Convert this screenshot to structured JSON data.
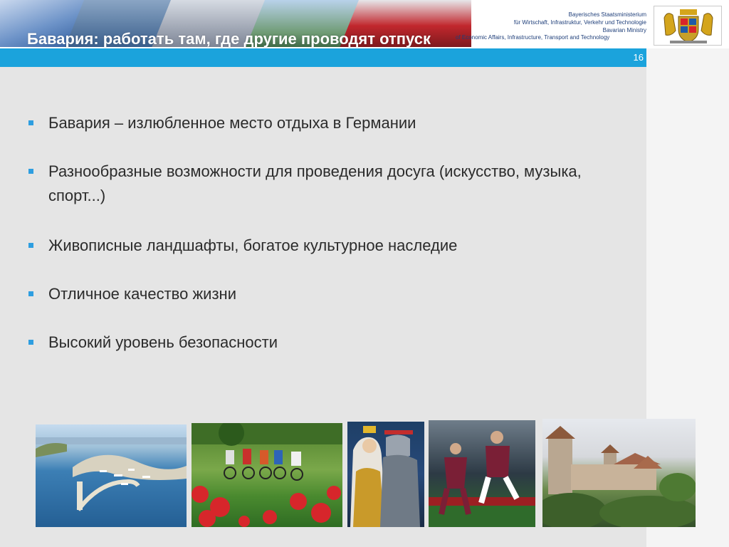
{
  "header": {
    "title": "Бавария: работать там, где другие проводят отпуск",
    "ministry_lines": [
      "Bayerisches Staatsministerium",
      "für Wirtschaft, Infrastruktur, Verkehr und Technologie",
      "Bavarian Ministry",
      "of Economic Affairs, Infrastructure, Transport and Technology"
    ],
    "page_number": "16"
  },
  "bullets": [
    {
      "text": "Бавария – излюбленное место отдыха в Германии"
    },
    {
      "text": "Разнообразные возможности для проведения досуга (искусство, музыка, спорт...)"
    },
    {
      "text": "Живописные ландшафты, богатое культурное наследие"
    },
    {
      "text": "Отличное качество жизни"
    },
    {
      "text": "Высокий уровень безопасности"
    }
  ],
  "photos": [
    {
      "icon": "harbor-photo"
    },
    {
      "icon": "cyclists-photo"
    },
    {
      "icon": "costume-knight-photo"
    },
    {
      "icon": "football-players-photo"
    },
    {
      "icon": "castle-photo"
    }
  ],
  "colors": {
    "accent_blue": "#1ba3dc",
    "bullet_blue": "#2e9ee0",
    "ministry_text": "#1f3f7a",
    "content_bg": "#e5e5e5"
  }
}
